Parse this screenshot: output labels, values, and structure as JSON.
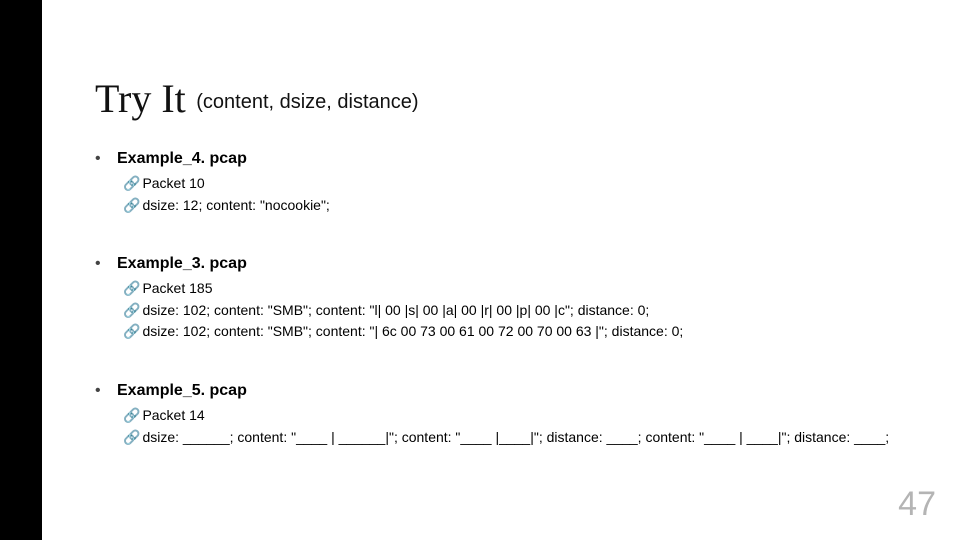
{
  "title": "Try It",
  "subtitle": "(content, dsize, distance)",
  "page_number": "47",
  "examples": [
    {
      "heading": "Example_4. pcap",
      "lines": [
        "Packet 10",
        "dsize: 12; content: \"nocookie\";"
      ]
    },
    {
      "heading": "Example_3. pcap",
      "lines": [
        "Packet 185",
        "dsize: 102; content: \"SMB\"; content: \"l| 00 |s| 00 |a| 00 |r| 00 |p| 00 |c\"; distance: 0;",
        "dsize: 102; content: \"SMB\"; content: \"| 6c 00 73 00 61 00 72 00 70 00 63 |\"; distance: 0;"
      ]
    },
    {
      "heading": "Example_5. pcap",
      "lines": [
        "Packet 14",
        "dsize: ______;  content: \"____ | ______|\";  content: \"____ |____|\";  distance: ____; content: \"____ | ____|\";  distance: ____;"
      ]
    }
  ]
}
